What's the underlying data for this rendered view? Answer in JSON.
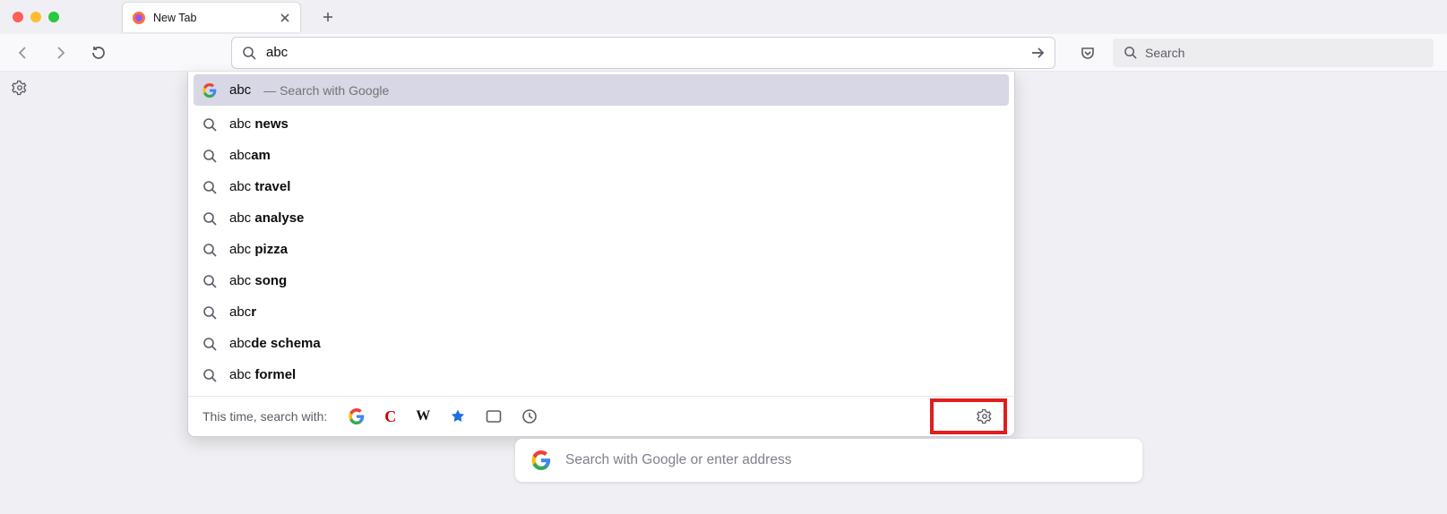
{
  "window": {
    "tab_title": "New Tab"
  },
  "urlbar": {
    "query": "abc",
    "search_with_hint": "—  Search with Google"
  },
  "suggestions": [
    {
      "prefix": "abc ",
      "bold": "news"
    },
    {
      "prefix": "abc",
      "bold": "am"
    },
    {
      "prefix": "abc ",
      "bold": "travel"
    },
    {
      "prefix": "abc ",
      "bold": "analyse"
    },
    {
      "prefix": "abc ",
      "bold": "pizza"
    },
    {
      "prefix": "abc ",
      "bold": "song"
    },
    {
      "prefix": "abc",
      "bold": "r"
    },
    {
      "prefix": "abc",
      "bold": "de schema"
    },
    {
      "prefix": "abc ",
      "bold": "formel"
    }
  ],
  "footer": {
    "label": "This time, search with:"
  },
  "right_search": {
    "placeholder": "Search"
  },
  "main_search": {
    "placeholder": "Search with Google or enter address"
  }
}
